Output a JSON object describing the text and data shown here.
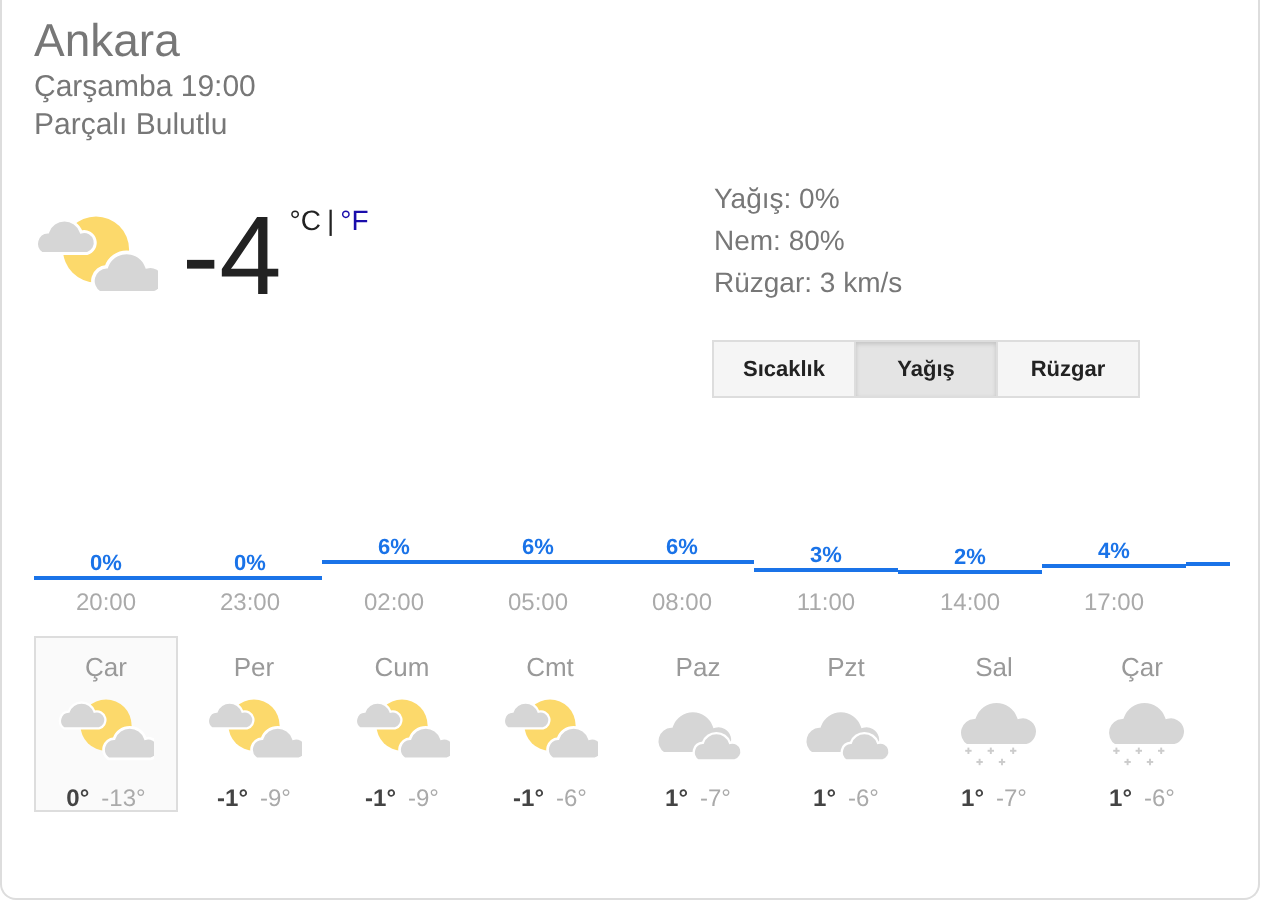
{
  "location": {
    "city": "Ankara",
    "datetime": "Çarşamba 19:00",
    "condition": "Parçalı Bulutlu"
  },
  "current": {
    "temperature": "-4",
    "separator": "|"
  },
  "units": [
    {
      "label": "°C",
      "selected": true
    },
    {
      "label": "°F",
      "selected": false
    }
  ],
  "details": [
    "Yağış: 0%",
    "Nem: 80%",
    "Rüzgar: 3 km/s"
  ],
  "tabs": [
    {
      "label": "Sıcaklık",
      "selected": false
    },
    {
      "label": "Yağış",
      "selected": true
    },
    {
      "label": "Rüzgar",
      "selected": false
    }
  ],
  "hours": [
    {
      "time": "20:00",
      "value": "0%"
    },
    {
      "time": "23:00",
      "value": "0%"
    },
    {
      "time": "02:00",
      "value": "6%"
    },
    {
      "time": "05:00",
      "value": "6%"
    },
    {
      "time": "08:00",
      "value": "6%"
    },
    {
      "time": "11:00",
      "value": "3%"
    },
    {
      "time": "14:00",
      "value": "2%"
    },
    {
      "time": "17:00",
      "value": "4%"
    }
  ],
  "days": [
    {
      "name": "Çar",
      "kind": "partly-cloudy",
      "high": "0°",
      "low": "-13°",
      "selected": true
    },
    {
      "name": "Per",
      "kind": "partly-cloudy",
      "high": "-1°",
      "low": "-9°",
      "selected": false
    },
    {
      "name": "Cum",
      "kind": "partly-cloudy",
      "high": "-1°",
      "low": "-9°",
      "selected": false
    },
    {
      "name": "Cmt",
      "kind": "partly-cloudy",
      "high": "-1°",
      "low": "-6°",
      "selected": false
    },
    {
      "name": "Paz",
      "kind": "cloudy",
      "high": "1°",
      "low": "-7°",
      "selected": false
    },
    {
      "name": "Pzt",
      "kind": "cloudy",
      "high": "1°",
      "low": "-6°",
      "selected": false
    },
    {
      "name": "Sal",
      "kind": "snow",
      "high": "1°",
      "low": "-7°",
      "selected": false
    },
    {
      "name": "Çar",
      "kind": "snow",
      "high": "1°",
      "low": "-6°",
      "selected": false
    }
  ]
}
